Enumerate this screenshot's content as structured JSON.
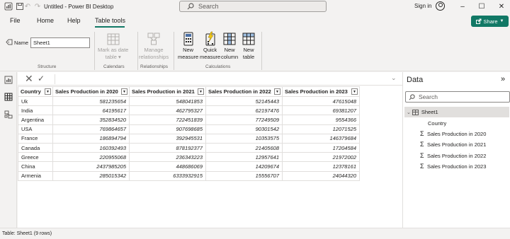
{
  "window": {
    "title": "Untitled - Power BI Desktop",
    "search_label": "Search",
    "signin_label": "Sign in",
    "minimize": "–",
    "maximize": "☐",
    "close": "✕"
  },
  "tabs": [
    {
      "label": "File"
    },
    {
      "label": "Home"
    },
    {
      "label": "Help"
    },
    {
      "label": "Table tools",
      "active": true
    }
  ],
  "share": {
    "label": "Share"
  },
  "ribbon": {
    "name_label": "Name",
    "name_value": "Sheet1",
    "groups": {
      "structure": "Structure",
      "calendars": "Calendars",
      "relationships": "Relationships",
      "calculations": "Calculations"
    },
    "mark_as_date_table": {
      "line1": "Mark as date",
      "line2": "table ▾"
    },
    "manage_relationships": {
      "line1": "Manage",
      "line2": "relationships"
    },
    "new_measure": {
      "line1": "New",
      "line2": "measure"
    },
    "quick_measure": {
      "line1": "Quick",
      "line2": "measure"
    },
    "new_column": {
      "line1": "New",
      "line2": "column"
    },
    "new_table": {
      "line1": "New",
      "line2": "table"
    }
  },
  "table": {
    "columns": [
      "Country",
      "Sales Production in 2020",
      "Sales Production in 2021",
      "Sales Production in 2022",
      "Sales Production in 2023"
    ],
    "rows": [
      [
        "Uk",
        "581235654",
        "548041853",
        "52145443",
        "47615048"
      ],
      [
        "India",
        "64195617",
        "462795327",
        "62197476",
        "69381207"
      ],
      [
        "Argentina",
        "352834520",
        "722451839",
        "77249509",
        "9554366"
      ],
      [
        "USA",
        "769864657",
        "907698685",
        "90301542",
        "12071525"
      ],
      [
        "France",
        "186894794",
        "392945531",
        "10353575",
        "146379684"
      ],
      [
        "Canada",
        "160392493",
        "878192377",
        "21405608",
        "17204584"
      ],
      [
        "Greece",
        "220955068",
        "236343223",
        "12957641",
        "21972002"
      ],
      [
        "China",
        "2437985205",
        "448686069",
        "14209674",
        "12378161"
      ],
      [
        "Armenia",
        "285015342",
        "6333932915",
        "15556707",
        "24044320"
      ]
    ]
  },
  "data_pane": {
    "title": "Data",
    "search_label": "Search",
    "table_name": "Sheet1",
    "fields": [
      {
        "name": "Country",
        "sigma": false
      },
      {
        "name": "Sales Production in 2020",
        "sigma": true
      },
      {
        "name": "Sales Production in 2021",
        "sigma": true
      },
      {
        "name": "Sales Production in 2022",
        "sigma": true
      },
      {
        "name": "Sales Production in 2023",
        "sigma": true
      }
    ]
  },
  "status": {
    "text": "Table: Sheet1 (9 rows)"
  },
  "colors": {
    "accent": "#117865",
    "selection": "#e1dfdd"
  }
}
